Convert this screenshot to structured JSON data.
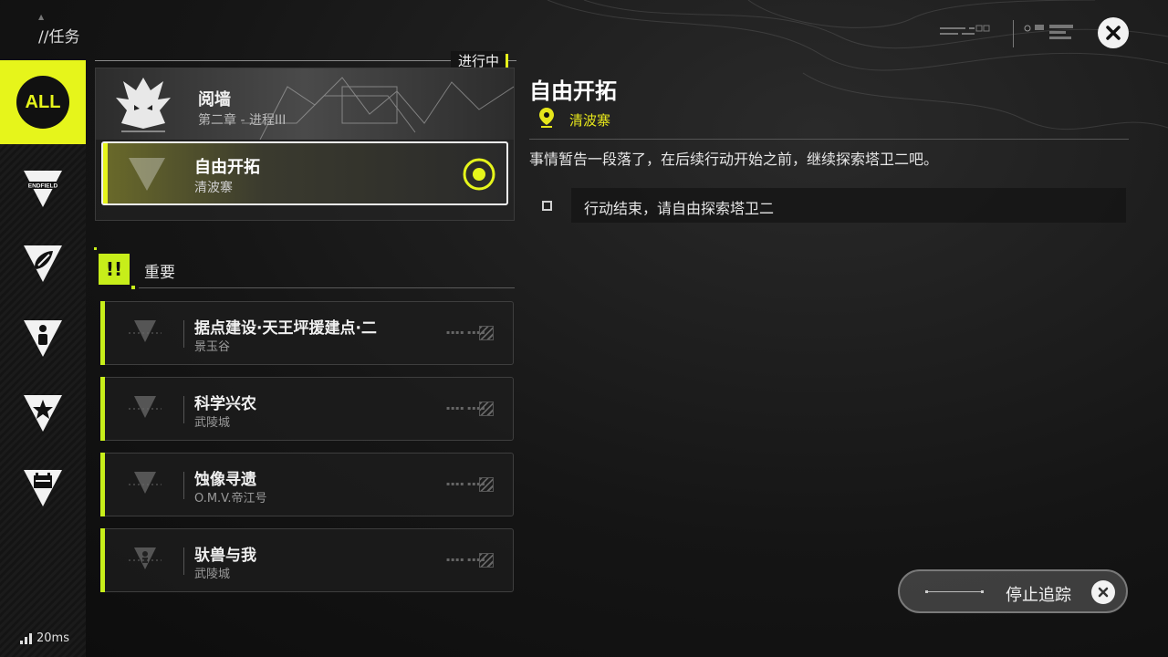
{
  "header": {
    "title": "//任务"
  },
  "sidebar": {
    "items": [
      {
        "label": "ALL",
        "icon": "all-icon",
        "active": true
      },
      {
        "label": "ENDFIELD",
        "icon": "endfield-icon",
        "active": false
      },
      {
        "label": "",
        "icon": "leaf-triangle-icon",
        "active": false
      },
      {
        "label": "",
        "icon": "person-triangle-icon",
        "active": false
      },
      {
        "label": "",
        "icon": "star-triangle-icon",
        "active": false
      },
      {
        "label": "",
        "icon": "calendar-triangle-icon",
        "active": false
      }
    ]
  },
  "list": {
    "status_tag": "进行中",
    "chapter": {
      "title": "阅墙",
      "subtitle": "第二章 - 进程III"
    },
    "active_mission": {
      "title": "自由开拓",
      "location": "清波寨"
    },
    "important": {
      "badge": "!!",
      "label": "重要",
      "tasks": [
        {
          "title": "据点建设·天王坪援建点·二",
          "location": "景玉谷"
        },
        {
          "title": "科学兴农",
          "location": "武陵城"
        },
        {
          "title": "蚀像寻遗",
          "location": "O.M.V.帝江号"
        },
        {
          "title": "驮兽与我",
          "location": "武陵城"
        }
      ]
    }
  },
  "detail": {
    "title": "自由开拓",
    "location": "清波寨",
    "description": "事情暂告一段落了，在后续行动开始之前，继续探索塔卫二吧。",
    "objective": "行动结束，请自由探索塔卫二"
  },
  "actions": {
    "stop_tracking": "停止追踪"
  },
  "status": {
    "ping": "20ms"
  },
  "colors": {
    "accent": "#e6f51b",
    "important": "#c7ee1a",
    "location": "#e6e61b"
  }
}
